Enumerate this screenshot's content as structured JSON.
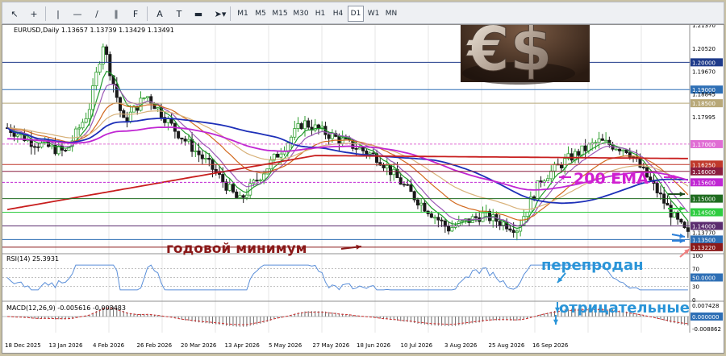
{
  "toolbar": {
    "tools": [
      {
        "icon": "cursor-icon",
        "glyph": "↖"
      },
      {
        "icon": "crosshair-icon",
        "glyph": "+"
      },
      {
        "icon": "vertical-line-icon",
        "glyph": "|"
      },
      {
        "icon": "horizontal-line-icon",
        "glyph": "—"
      },
      {
        "icon": "trendline-icon",
        "glyph": "/"
      },
      {
        "icon": "channel-icon",
        "glyph": "∥"
      },
      {
        "icon": "fibonacci-icon",
        "glyph": "F"
      },
      {
        "icon": "text-icon",
        "glyph": "A"
      },
      {
        "icon": "label-icon",
        "glyph": "T"
      },
      {
        "icon": "shape-icon",
        "glyph": "▬"
      },
      {
        "icon": "arrows-dropdown-icon",
        "glyph": "➤▾"
      }
    ],
    "timeframes": [
      "M1",
      "M5",
      "M15",
      "M30",
      "H1",
      "H4",
      "D1",
      "W1",
      "MN"
    ],
    "active_timeframe": "D1"
  },
  "chart": {
    "symbol_line": "EURUSD,Daily  1.13657 1.13739 1.13429 1.13491",
    "rsi_label": "RSI(14) 25.3931",
    "macd_label": "MACD(12,26,9) -0.005616 -0.003483",
    "price_labels": [
      {
        "text": "1.21370",
        "bg": "",
        "fg": "#000000"
      },
      {
        "text": "1.20520",
        "bg": "",
        "fg": "#000000"
      },
      {
        "text": "1.20000",
        "bg": "#1e3a8a",
        "fg": "#ffffff"
      },
      {
        "text": "1.19670",
        "bg": "",
        "fg": "#000000"
      },
      {
        "text": "1.19000",
        "bg": "#2e6fb5",
        "fg": "#ffffff"
      },
      {
        "text": "1.18845",
        "bg": "",
        "fg": "#000000"
      },
      {
        "text": "1.18500",
        "bg": "#b8a878",
        "fg": "#ffffff"
      },
      {
        "text": "1.17995",
        "bg": "",
        "fg": "#000000"
      },
      {
        "text": "1.17000",
        "bg": "#e06dd4",
        "fg": "#ffffff"
      },
      {
        "text": "1.16250",
        "bg": "#c0392b",
        "fg": "#ffffff"
      },
      {
        "text": "1.16000",
        "bg": "#8b1e3f",
        "fg": "#ffffff"
      },
      {
        "text": "1.15600",
        "bg": "#c026d3",
        "fg": "#ffffff"
      },
      {
        "text": "1.15000",
        "bg": "#1f6b1f",
        "fg": "#ffffff"
      },
      {
        "text": "1.14500",
        "bg": "#2ecc40",
        "fg": "#ffffff"
      },
      {
        "text": "1.14000",
        "bg": "#5b2c6f",
        "fg": "#ffffff"
      },
      {
        "text": "1.13770",
        "bg": "",
        "fg": "#000000"
      },
      {
        "text": "1.13500",
        "bg": "#2e6fb5",
        "fg": "#ffffff"
      },
      {
        "text": "1.13220",
        "bg": "#8b1a1a",
        "fg": "#ffffff"
      }
    ],
    "rsi_scale": [
      "100",
      "70",
      "50.0000",
      "30",
      "0"
    ],
    "macd_scale": [
      "0.007428",
      "0.000000",
      "-0.008862"
    ],
    "x_labels": [
      "18 Dec 2025",
      "13 Jan 2026",
      "4 Feb 2026",
      "26 Feb 2026",
      "20 Mar 2026",
      "13 Apr 2026",
      "5 May 2026",
      "27 May 2026",
      "18 Jun 2026",
      "10 Jul 2026",
      "3 Aug 2026",
      "25 Aug 2026",
      "16 Sep 2026"
    ],
    "colors": {
      "bull": "#2f9e2f",
      "bear": "#1a1a1a",
      "ema200": "#c81e1e",
      "ma_blue": "#1d2fb8",
      "ma_magenta": "#c026d3",
      "ma_orange": "#d2691e",
      "ma_tan": "#d8b27a",
      "ma_green": "#1f9a2a",
      "ma_violet": "#9b59b6",
      "rsi": "#5b8fd9"
    }
  },
  "annotations": {
    "ema_label": "200 EMA",
    "yearly_min": "годовой минимум",
    "oversold": "перепродан",
    "negative": "отрицательные"
  },
  "inset": {
    "symbols": "€$"
  }
}
